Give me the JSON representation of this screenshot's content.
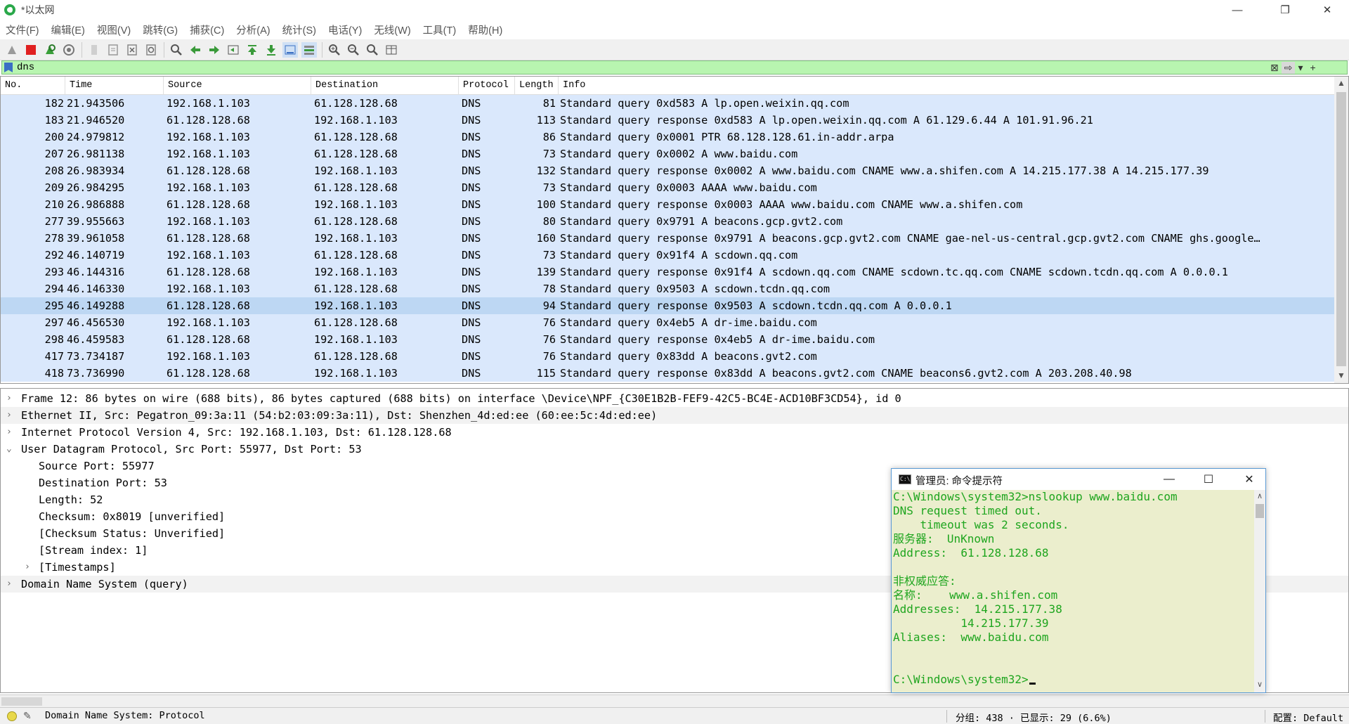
{
  "window": {
    "title": "*以太网",
    "minimize": "—",
    "restore": "❐",
    "close": "✕"
  },
  "menu": [
    "文件(F)",
    "编辑(E)",
    "视图(V)",
    "跳转(G)",
    "捕获(C)",
    "分析(A)",
    "统计(S)",
    "电话(Y)",
    "无线(W)",
    "工具(T)",
    "帮助(H)"
  ],
  "filter": {
    "value": "dns",
    "clear_icon": "⊠",
    "apply_icon": "⇨",
    "dropdown_icon": "▾",
    "add_icon": "+"
  },
  "packet_list": {
    "columns": [
      "No.",
      "Time",
      "Source",
      "Destination",
      "Protocol",
      "Length",
      "Info"
    ],
    "rows": [
      {
        "no": "182",
        "time": "21.943506",
        "src": "192.168.1.103",
        "dst": "61.128.128.68",
        "proto": "DNS",
        "len": "81",
        "info": "Standard query 0xd583 A lp.open.weixin.qq.com"
      },
      {
        "no": "183",
        "time": "21.946520",
        "src": "61.128.128.68",
        "dst": "192.168.1.103",
        "proto": "DNS",
        "len": "113",
        "info": "Standard query response 0xd583 A lp.open.weixin.qq.com A 61.129.6.44 A 101.91.96.21"
      },
      {
        "no": "200",
        "time": "24.979812",
        "src": "192.168.1.103",
        "dst": "61.128.128.68",
        "proto": "DNS",
        "len": "86",
        "info": "Standard query 0x0001 PTR 68.128.128.61.in-addr.arpa"
      },
      {
        "no": "207",
        "time": "26.981138",
        "src": "192.168.1.103",
        "dst": "61.128.128.68",
        "proto": "DNS",
        "len": "73",
        "info": "Standard query 0x0002 A www.baidu.com"
      },
      {
        "no": "208",
        "time": "26.983934",
        "src": "61.128.128.68",
        "dst": "192.168.1.103",
        "proto": "DNS",
        "len": "132",
        "info": "Standard query response 0x0002 A www.baidu.com CNAME www.a.shifen.com A 14.215.177.38 A 14.215.177.39"
      },
      {
        "no": "209",
        "time": "26.984295",
        "src": "192.168.1.103",
        "dst": "61.128.128.68",
        "proto": "DNS",
        "len": "73",
        "info": "Standard query 0x0003 AAAA www.baidu.com"
      },
      {
        "no": "210",
        "time": "26.986888",
        "src": "61.128.128.68",
        "dst": "192.168.1.103",
        "proto": "DNS",
        "len": "100",
        "info": "Standard query response 0x0003 AAAA www.baidu.com CNAME www.a.shifen.com"
      },
      {
        "no": "277",
        "time": "39.955663",
        "src": "192.168.1.103",
        "dst": "61.128.128.68",
        "proto": "DNS",
        "len": "80",
        "info": "Standard query 0x9791 A beacons.gcp.gvt2.com"
      },
      {
        "no": "278",
        "time": "39.961058",
        "src": "61.128.128.68",
        "dst": "192.168.1.103",
        "proto": "DNS",
        "len": "160",
        "info": "Standard query response 0x9791 A beacons.gcp.gvt2.com CNAME gae-nel-us-central.gcp.gvt2.com CNAME ghs.google…"
      },
      {
        "no": "292",
        "time": "46.140719",
        "src": "192.168.1.103",
        "dst": "61.128.128.68",
        "proto": "DNS",
        "len": "73",
        "info": "Standard query 0x91f4 A scdown.qq.com"
      },
      {
        "no": "293",
        "time": "46.144316",
        "src": "61.128.128.68",
        "dst": "192.168.1.103",
        "proto": "DNS",
        "len": "139",
        "info": "Standard query response 0x91f4 A scdown.qq.com CNAME scdown.tc.qq.com CNAME scdown.tcdn.qq.com A 0.0.0.1"
      },
      {
        "no": "294",
        "time": "46.146330",
        "src": "192.168.1.103",
        "dst": "61.128.128.68",
        "proto": "DNS",
        "len": "78",
        "info": "Standard query 0x9503 A scdown.tcdn.qq.com"
      },
      {
        "no": "295",
        "time": "46.149288",
        "src": "61.128.128.68",
        "dst": "192.168.1.103",
        "proto": "DNS",
        "len": "94",
        "info": "Standard query response 0x9503 A scdown.tcdn.qq.com A 0.0.0.1"
      },
      {
        "no": "297",
        "time": "46.456530",
        "src": "192.168.1.103",
        "dst": "61.128.128.68",
        "proto": "DNS",
        "len": "76",
        "info": "Standard query 0x4eb5 A dr-ime.baidu.com"
      },
      {
        "no": "298",
        "time": "46.459583",
        "src": "61.128.128.68",
        "dst": "192.168.1.103",
        "proto": "DNS",
        "len": "76",
        "info": "Standard query response 0x4eb5 A dr-ime.baidu.com"
      },
      {
        "no": "417",
        "time": "73.734187",
        "src": "192.168.1.103",
        "dst": "61.128.128.68",
        "proto": "DNS",
        "len": "76",
        "info": "Standard query 0x83dd A beacons.gvt2.com"
      },
      {
        "no": "418",
        "time": "73.736990",
        "src": "61.128.128.68",
        "dst": "192.168.1.103",
        "proto": "DNS",
        "len": "115",
        "info": "Standard query response 0x83dd A beacons.gvt2.com CNAME beacons6.gvt2.com A 203.208.40.98"
      }
    ]
  },
  "details": [
    {
      "chev": "›",
      "text": "Frame 12: 86 bytes on wire (688 bits), 86 bytes captured (688 bits) on interface \\Device\\NPF_{C30E1B2B-FEF9-42C5-BC4E-ACD10BF3CD54}, id 0"
    },
    {
      "chev": "›",
      "text": "Ethernet II, Src: Pegatron_09:3a:11 (54:b2:03:09:3a:11), Dst: Shenzhen_4d:ed:ee (60:ee:5c:4d:ed:ee)"
    },
    {
      "chev": "›",
      "text": "Internet Protocol Version 4, Src: 192.168.1.103, Dst: 61.128.128.68"
    },
    {
      "chev": "⌄",
      "text": "User Datagram Protocol, Src Port: 55977, Dst Port: 53"
    },
    {
      "chev": "",
      "text": "Source Port: 55977"
    },
    {
      "chev": "",
      "text": "Destination Port: 53"
    },
    {
      "chev": "",
      "text": "Length: 52"
    },
    {
      "chev": "",
      "text": "Checksum: 0x8019 [unverified]"
    },
    {
      "chev": "",
      "text": "[Checksum Status: Unverified]"
    },
    {
      "chev": "",
      "text": "[Stream index: 1]"
    },
    {
      "chev": "›",
      "text": "[Timestamps]"
    },
    {
      "chev": "›",
      "text": "Domain Name System (query)"
    }
  ],
  "cmd": {
    "title": "管理员: 命令提示符",
    "icon_text": "C:\\",
    "lines": [
      "C:\\Windows\\system32>nslookup www.baidu.com",
      "DNS request timed out.",
      "    timeout was 2 seconds.",
      "服务器:  UnKnown",
      "Address:  61.128.128.68",
      "",
      "非权威应答:",
      "名称:    www.a.shifen.com",
      "Addresses:  14.215.177.38",
      "          14.215.177.39",
      "Aliases:  www.baidu.com",
      "",
      "",
      "C:\\Windows\\system32>"
    ]
  },
  "status": {
    "left": "Domain Name System: Protocol",
    "packets": "分组: 438 · 已显示: 29 (6.6%)",
    "profile": "配置: Default"
  }
}
